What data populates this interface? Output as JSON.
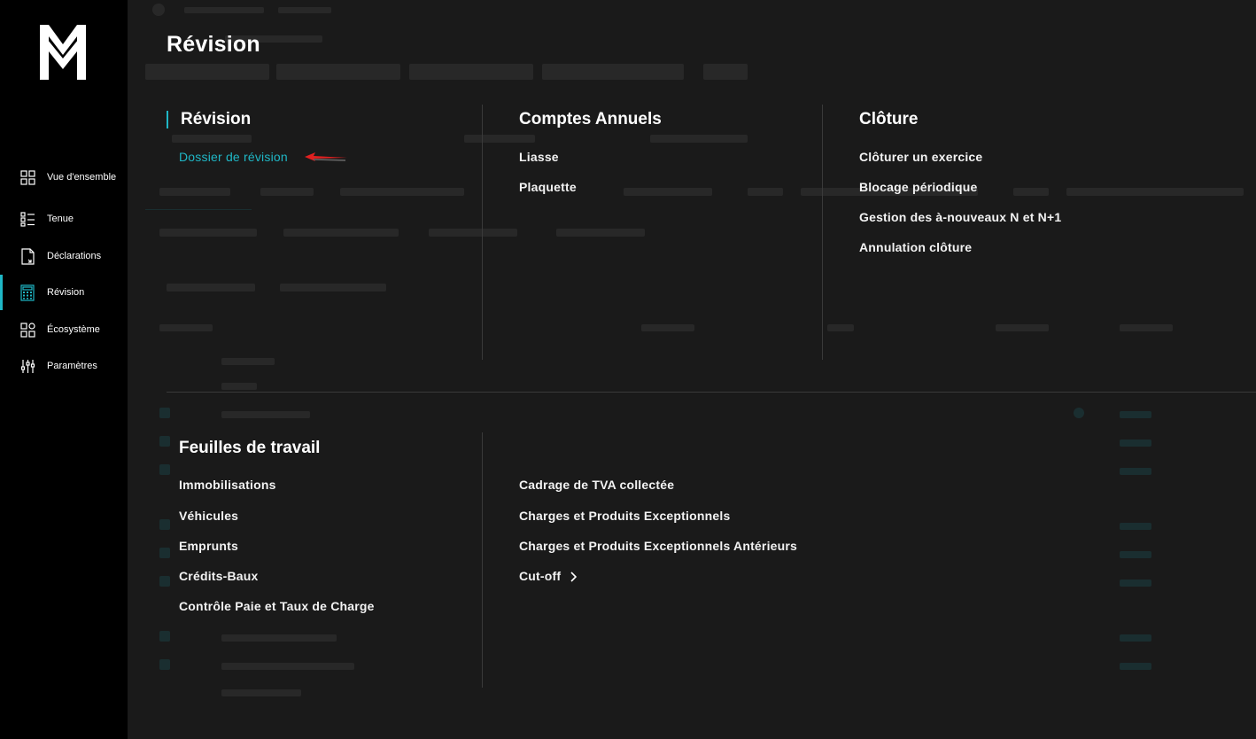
{
  "sidebar": {
    "logo_alt": "M",
    "items": [
      {
        "label": "Vue d'ensemble",
        "icon": "dashboard-grid-icon"
      },
      {
        "label": "Tenue",
        "icon": "list-icon"
      },
      {
        "label": "Déclarations",
        "icon": "document-icon"
      },
      {
        "label": "Révision",
        "icon": "calculator-icon",
        "active": true
      },
      {
        "label": "Écosystème",
        "icon": "ecosystem-icon"
      },
      {
        "label": "Paramètres",
        "icon": "sliders-icon"
      }
    ]
  },
  "menu": {
    "title": "Révision",
    "revision": {
      "title": "Révision",
      "links": [
        "Dossier de révision"
      ]
    },
    "comptes": {
      "title": "Comptes Annuels",
      "links": [
        "Liasse",
        "Plaquette"
      ]
    },
    "cloture": {
      "title": "Clôture",
      "links": [
        "Clôturer un exercice",
        "Blocage périodique",
        "Gestion des à-nouveaux N et N+1",
        "Annulation clôture"
      ]
    },
    "feuilles": {
      "title": "Feuilles de travail",
      "col1": [
        "Immobilisations",
        "Véhicules",
        "Emprunts",
        "Crédits-Baux",
        "Contrôle Paie et Taux de Charge"
      ],
      "col2": [
        "Cadrage de TVA collectée",
        "Charges et Produits Exceptionnels",
        "Charges et Produits Exceptionnels Antérieurs",
        "Cut-off"
      ]
    }
  },
  "colors": {
    "accent": "#1fb7c6",
    "arrow": "#e02020",
    "sidebar_bg": "#000000",
    "overlay_bg": "#1a1a1a"
  }
}
